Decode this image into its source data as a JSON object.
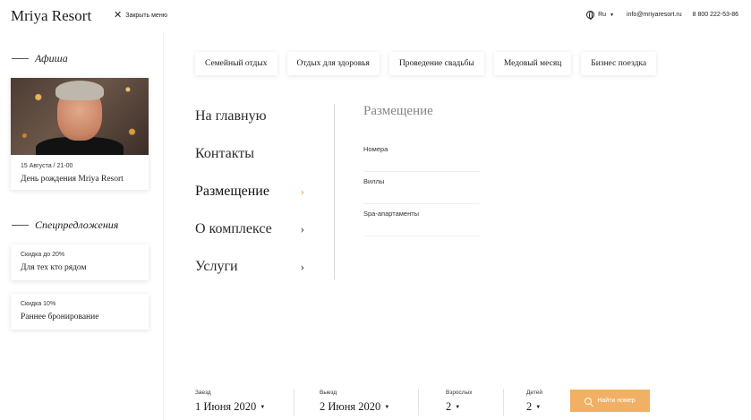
{
  "header": {
    "logo": "Mriya Resort",
    "close_menu": "Закрыть меню",
    "lang": "Ru",
    "email": "info@mriyaresort.ru",
    "phone": "8 800 222-53-86"
  },
  "sidebar": {
    "afisha_title": "Афиша",
    "event": {
      "date": "15 Августа  /  21-00",
      "name": "День рождения Mriya Resort"
    },
    "specials_title": "Спецпредложения",
    "offers": [
      {
        "small": "Скидка до 20%",
        "name": "Для тех кто рядом"
      },
      {
        "small": "Скидка 10%",
        "name": "Раннее бронирование"
      }
    ]
  },
  "categories": [
    "Семейный отдых",
    "Отдых для здоровья",
    "Проведение свадьбы",
    "Медовый месяц",
    "Бизнес поездка"
  ],
  "menu": [
    {
      "label": "На главную",
      "has_arrow": false
    },
    {
      "label": "Контакты",
      "has_arrow": false
    },
    {
      "label": "Размещение",
      "has_arrow": true,
      "active": true
    },
    {
      "label": "О комплексе",
      "has_arrow": true
    },
    {
      "label": "Услуги",
      "has_arrow": true
    }
  ],
  "submenu": {
    "title": "Размещение",
    "items": [
      "Номера",
      "Виллы",
      "Spa-апартаменты"
    ]
  },
  "booking": {
    "checkin_label": "Заезд",
    "checkin_value": "1 Июня 2020",
    "checkout_label": "Выезд",
    "checkout_value": "2 Июня 2020",
    "adults_label": "Взрослых",
    "adults_value": "2",
    "children_label": "Детей",
    "children_value": "2",
    "search_label": "Найти номер"
  },
  "colors": {
    "accent": "#f1b063",
    "active_arrow": "#e09b4e"
  }
}
